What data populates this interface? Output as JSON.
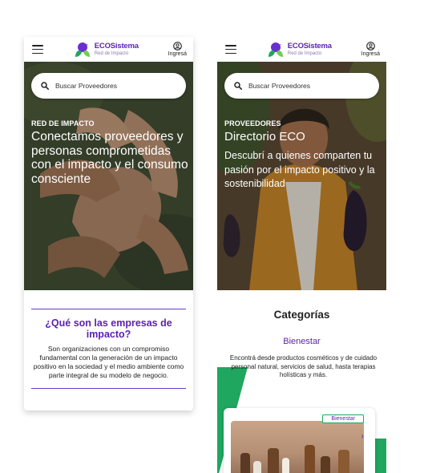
{
  "brand": {
    "name": "ECOSistema",
    "tagline": "Red de Impacto"
  },
  "header": {
    "login_label": "Ingresá"
  },
  "search": {
    "placeholder": "Buscar Proveedores"
  },
  "left_screen": {
    "hero": {
      "kicker": "RED DE IMPACTO",
      "title": "Conectamos proveedores y personas comprometidas con el impacto y el consumo consciente"
    },
    "info": {
      "title": "¿Qué son las empresas de impacto?",
      "text": "Son organizaciones con un compromiso fundamental con la generación de un impacto positivo en la sociedad y el medio ambiente como parte integral de su modelo de negocio."
    }
  },
  "right_screen": {
    "hero": {
      "kicker": "PROVEEDORES",
      "title": "Directorio ECO",
      "description": "Descubrí a quienes comparten tu pasión por el impacto positivo y la sostenibilidad"
    },
    "categories": {
      "title": "Categorías",
      "current": "Bienestar",
      "description": "Encontrá desde productos cosméticos y de cuidado personal natural, servicios de salud, hasta terapias holísticas y más.",
      "card_badge": "Bienestar"
    }
  },
  "colors": {
    "brand_purple": "#5a1fb5",
    "accent_green": "#1fa65f",
    "text_dark": "#222222"
  },
  "icons": {
    "menu": "hamburger-icon",
    "logo": "leaf-bird-logo",
    "user": "user-circle-icon",
    "search": "search-icon",
    "next": "chevron-right-icon"
  }
}
